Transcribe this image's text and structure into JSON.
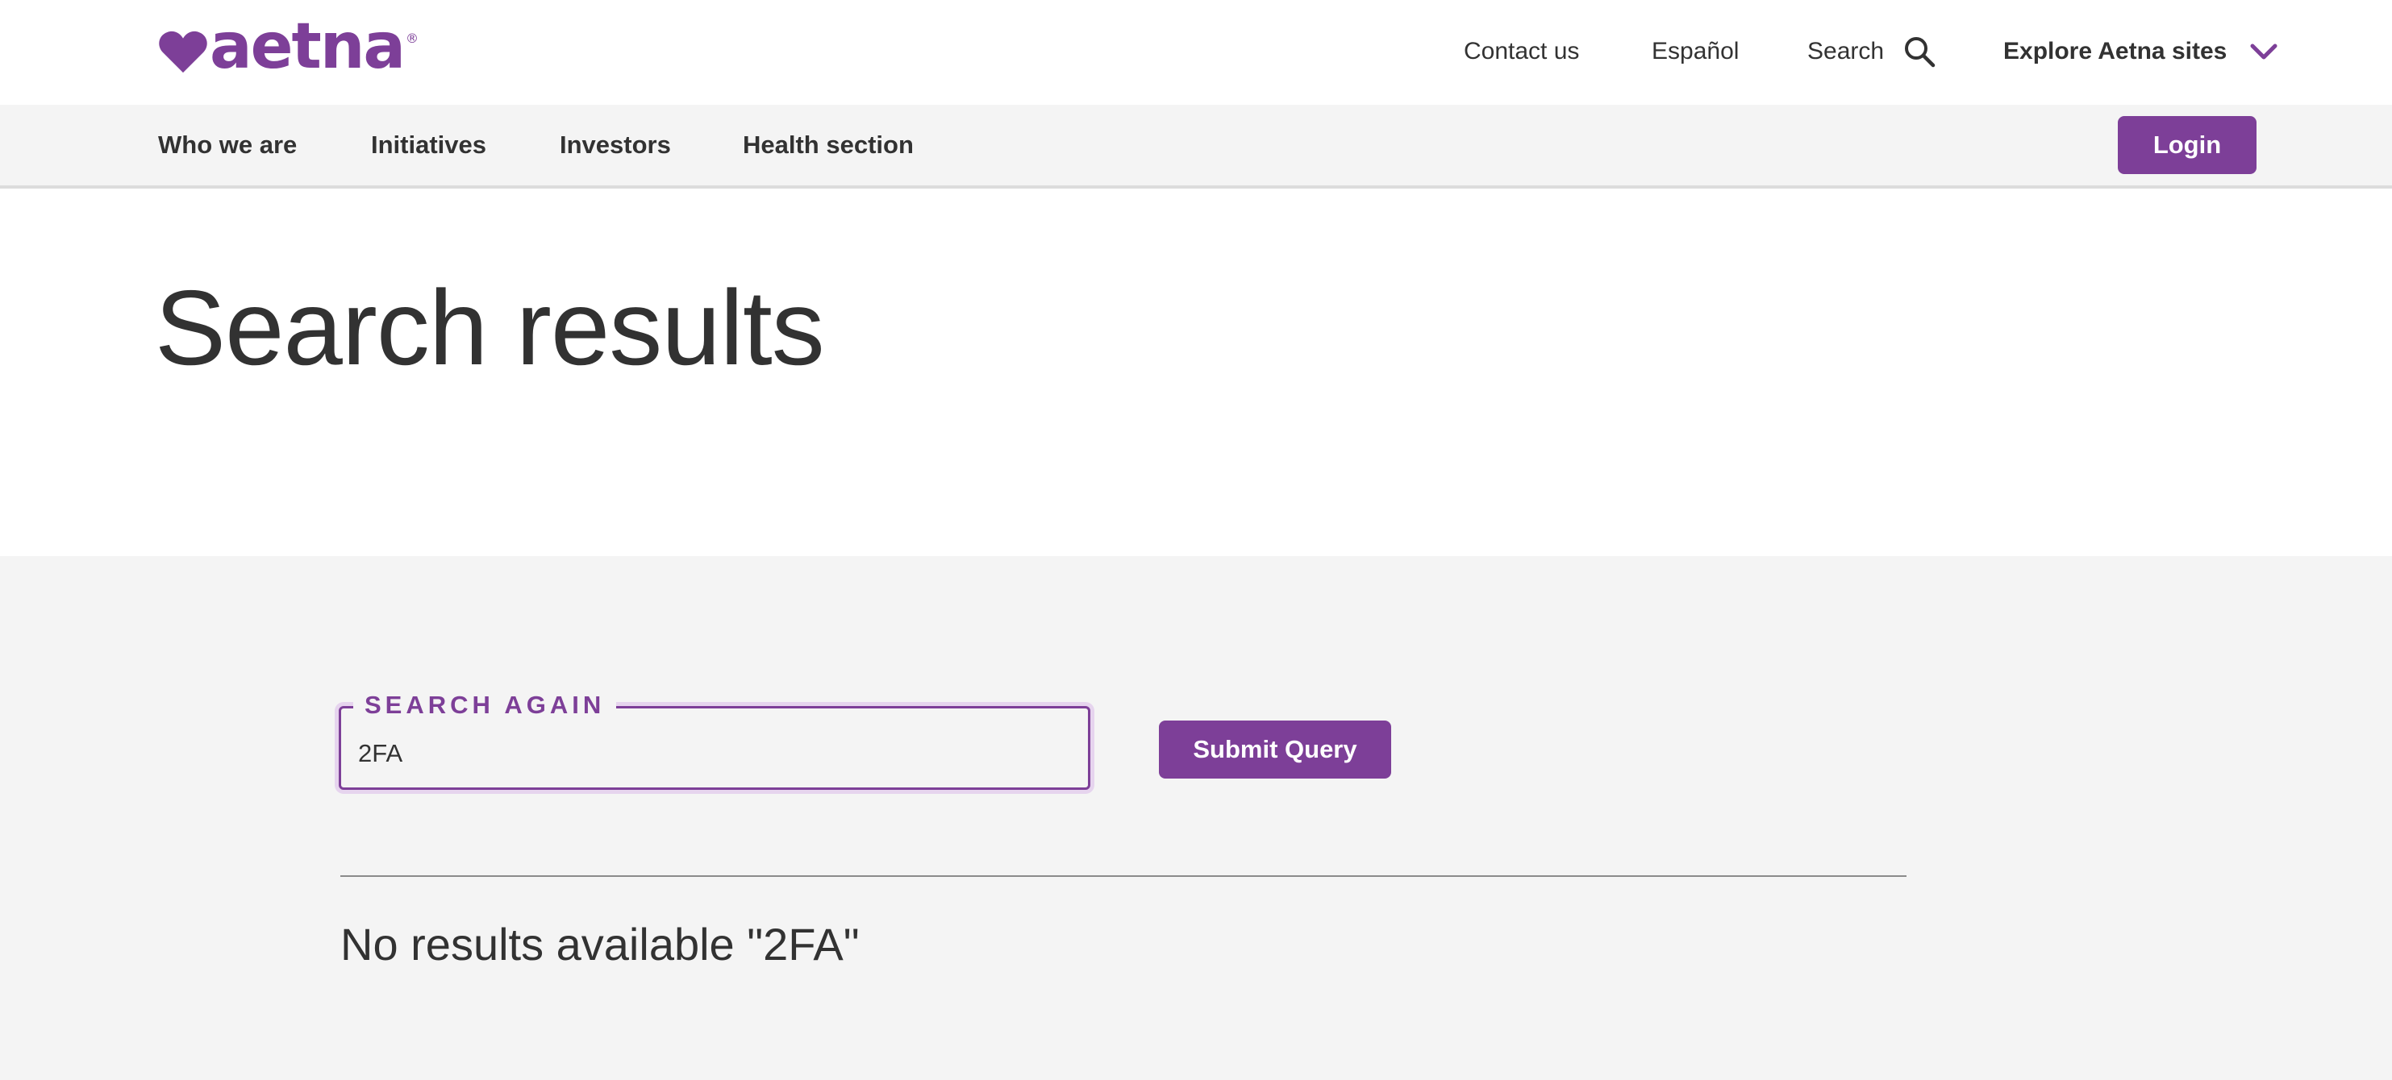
{
  "brand": {
    "name": "aetna",
    "registered": "®",
    "accent_color": "#7d3f98"
  },
  "utility_nav": {
    "contact": "Contact us",
    "espanol": "Español",
    "search": "Search",
    "explore": "Explore Aetna sites"
  },
  "main_nav": {
    "items": [
      "Who we are",
      "Initiatives",
      "Investors",
      "Health section"
    ],
    "login": "Login"
  },
  "hero": {
    "title": "Search results"
  },
  "search": {
    "legend": "SEARCH AGAIN",
    "value": "2FA",
    "submit": "Submit Query",
    "no_results": "No results available \"2FA\""
  },
  "icons": {
    "logo": "heart-logo-icon",
    "search": "search-icon",
    "explore": "chevron-down-icon"
  }
}
